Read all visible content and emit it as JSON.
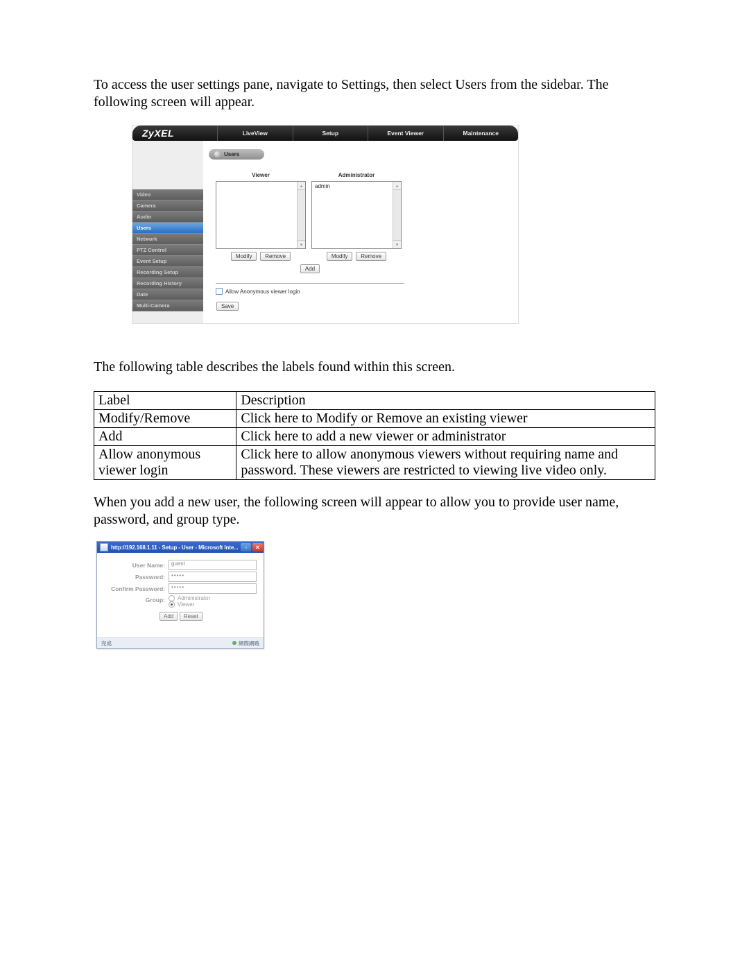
{
  "intro": "To access the user settings pane, navigate to Settings, then select Users from the sidebar. The following screen will appear.",
  "second": "The following table describes the labels found within this screen.",
  "third": "When you add a new user, the following screen will appear to allow you to provide user name, password, and group type.",
  "zy": {
    "logo": "ZyXEL",
    "nav": [
      "LiveView",
      "Setup",
      "Event Viewer",
      "Maintenance"
    ],
    "sidebar": [
      "Video",
      "Camera",
      "Audio",
      "Users",
      "Network",
      "PTZ Control",
      "Event Setup",
      "Recording Setup",
      "Recording History",
      "Date",
      "Multi-Camera"
    ],
    "sidebar_active_index": 3,
    "badge": "Users",
    "col_viewer": "Viewer",
    "col_admin": "Administrator",
    "admin_items": [
      "admin"
    ],
    "btn_modify": "Modify",
    "btn_remove": "Remove",
    "btn_add": "Add",
    "allow_anon": "Allow Anonymous viewer login",
    "btn_save": "Save"
  },
  "desc_table": {
    "header": [
      "Label",
      "Description"
    ],
    "rows": [
      [
        "Modify/Remove",
        "Click here to Modify or Remove an existing viewer"
      ],
      [
        "Add",
        "Click here to add a new viewer or administrator"
      ],
      [
        "Allow anonymous viewer login",
        "Click here to allow anonymous viewers without requiring name and password. These viewers are restricted to viewing live video only."
      ]
    ]
  },
  "dlg": {
    "title": "http://192.168.1.11 - Setup - User - Microsoft Inte...",
    "username_label": "User Name:",
    "password_label": "Password:",
    "confirm_label": "Confirm Password:",
    "group_label": "Group:",
    "username_value": "guest",
    "password_value": "•••••",
    "confirm_value": "•••••",
    "radio_admin": "Administrator",
    "radio_viewer": "Viewer",
    "btn_add": "Add",
    "btn_reset": "Reset",
    "status_left": "完成",
    "status_right": "網際網路"
  }
}
